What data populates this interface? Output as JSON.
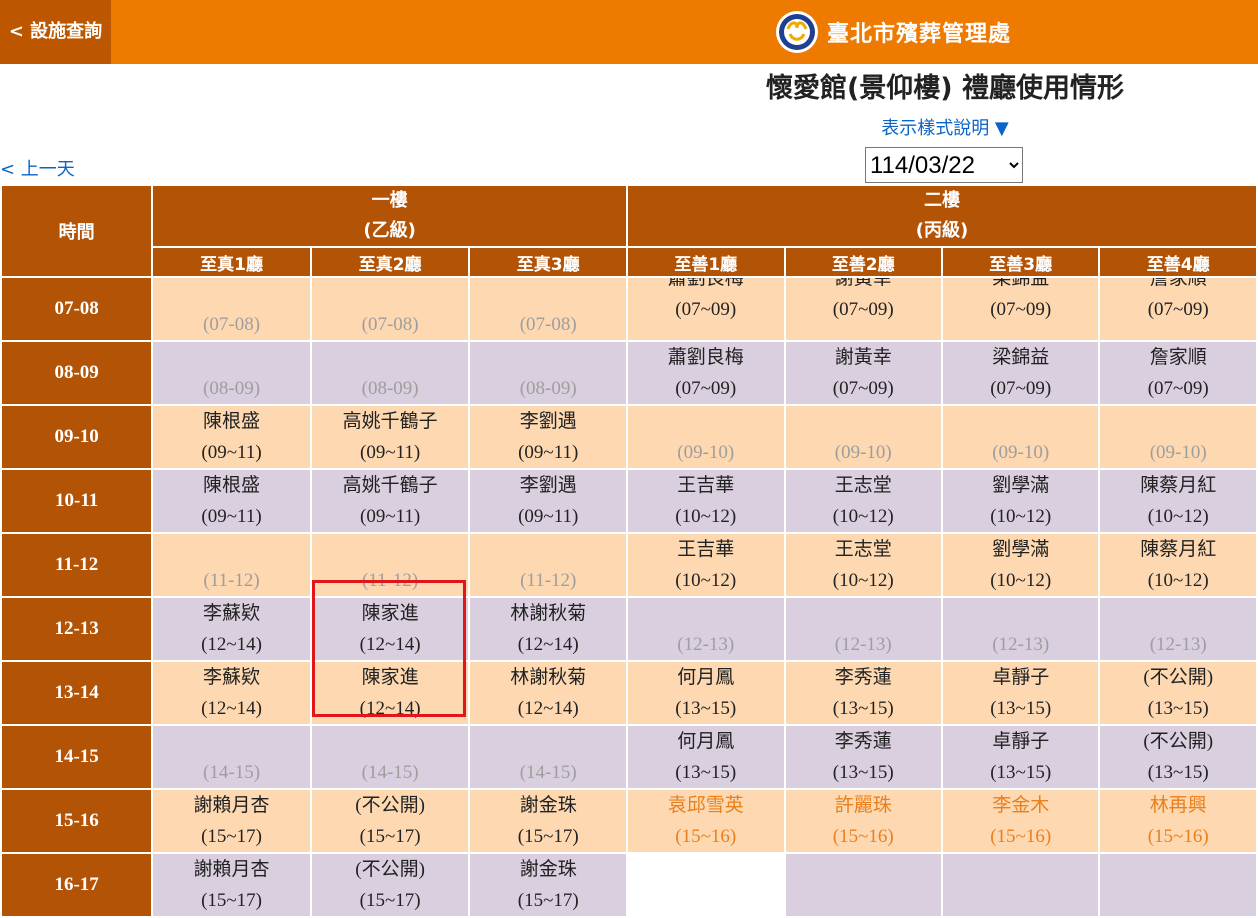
{
  "header": {
    "back_label": "< 設施查詢",
    "brand_name": "臺北市殯葬管理處",
    "bar_color": "#ee7b00",
    "back_color": "#bc5700",
    "logo_icon": "city-funeral-logo-icon"
  },
  "title": "懷愛館(景仰樓) 禮廳使用情形",
  "legend_link": "表示樣式說明 ▼",
  "prev_day": "< 上一天",
  "date_select": {
    "value": "114/03/22",
    "options": [
      "114/03/22"
    ]
  },
  "table": {
    "time_header": "時間",
    "floors": [
      {
        "name": "一樓",
        "grade": "(乙級)"
      },
      {
        "name": "二樓",
        "grade": "(丙級)"
      }
    ],
    "halls": [
      "至真1廳",
      "至真2廳",
      "至真3廳",
      "至善1廳",
      "至善2廳",
      "至善3廳",
      "至善4廳"
    ],
    "rows": [
      {
        "time": "07-08",
        "cells": [
          {
            "name": "",
            "time": "(07-08)",
            "bg": "peach",
            "empty": true
          },
          {
            "name": "",
            "time": "(07-08)",
            "bg": "peach",
            "empty": true
          },
          {
            "name": "",
            "time": "(07-08)",
            "bg": "peach",
            "empty": true
          },
          {
            "name": "蕭劉良梅",
            "time": "(07~09)",
            "bg": "peach",
            "clip": true
          },
          {
            "name": "謝黃幸",
            "time": "(07~09)",
            "bg": "peach",
            "clip": true
          },
          {
            "name": "梁錦益",
            "time": "(07~09)",
            "bg": "peach",
            "clip": true
          },
          {
            "name": "詹家順",
            "time": "(07~09)",
            "bg": "peach",
            "clip": true
          }
        ]
      },
      {
        "time": "08-09",
        "cells": [
          {
            "name": "",
            "time": "(08-09)",
            "bg": "lav",
            "empty": true
          },
          {
            "name": "",
            "time": "(08-09)",
            "bg": "lav",
            "empty": true
          },
          {
            "name": "",
            "time": "(08-09)",
            "bg": "lav",
            "empty": true
          },
          {
            "name": "蕭劉良梅",
            "time": "(07~09)",
            "bg": "lav"
          },
          {
            "name": "謝黃幸",
            "time": "(07~09)",
            "bg": "lav"
          },
          {
            "name": "梁錦益",
            "time": "(07~09)",
            "bg": "lav"
          },
          {
            "name": "詹家順",
            "time": "(07~09)",
            "bg": "lav"
          }
        ]
      },
      {
        "time": "09-10",
        "cells": [
          {
            "name": "陳根盛",
            "time": "(09~11)",
            "bg": "peach"
          },
          {
            "name": "高姚千鶴子",
            "time": "(09~11)",
            "bg": "peach"
          },
          {
            "name": "李劉遇",
            "time": "(09~11)",
            "bg": "peach"
          },
          {
            "name": "",
            "time": "(09-10)",
            "bg": "peach",
            "empty": true
          },
          {
            "name": "",
            "time": "(09-10)",
            "bg": "peach",
            "empty": true
          },
          {
            "name": "",
            "time": "(09-10)",
            "bg": "peach",
            "empty": true
          },
          {
            "name": "",
            "time": "(09-10)",
            "bg": "peach",
            "empty": true
          }
        ]
      },
      {
        "time": "10-11",
        "cells": [
          {
            "name": "陳根盛",
            "time": "(09~11)",
            "bg": "lav"
          },
          {
            "name": "高姚千鶴子",
            "time": "(09~11)",
            "bg": "lav"
          },
          {
            "name": "李劉遇",
            "time": "(09~11)",
            "bg": "lav"
          },
          {
            "name": "王吉華",
            "time": "(10~12)",
            "bg": "lav"
          },
          {
            "name": "王志堂",
            "time": "(10~12)",
            "bg": "lav"
          },
          {
            "name": "劉學滿",
            "time": "(10~12)",
            "bg": "lav"
          },
          {
            "name": "陳蔡月紅",
            "time": "(10~12)",
            "bg": "lav"
          }
        ]
      },
      {
        "time": "11-12",
        "cells": [
          {
            "name": "",
            "time": "(11-12)",
            "bg": "peach",
            "empty": true
          },
          {
            "name": "",
            "time": "(11-12)",
            "bg": "peach",
            "empty": true
          },
          {
            "name": "",
            "time": "(11-12)",
            "bg": "peach",
            "empty": true
          },
          {
            "name": "王吉華",
            "time": "(10~12)",
            "bg": "peach"
          },
          {
            "name": "王志堂",
            "time": "(10~12)",
            "bg": "peach"
          },
          {
            "name": "劉學滿",
            "time": "(10~12)",
            "bg": "peach"
          },
          {
            "name": "陳蔡月紅",
            "time": "(10~12)",
            "bg": "peach"
          }
        ]
      },
      {
        "time": "12-13",
        "cells": [
          {
            "name": "李蘇欵",
            "time": "(12~14)",
            "bg": "lav"
          },
          {
            "name": "陳家進",
            "time": "(12~14)",
            "bg": "lav"
          },
          {
            "name": "林謝秋菊",
            "time": "(12~14)",
            "bg": "lav"
          },
          {
            "name": "",
            "time": "(12-13)",
            "bg": "lav",
            "empty": true
          },
          {
            "name": "",
            "time": "(12-13)",
            "bg": "lav",
            "empty": true
          },
          {
            "name": "",
            "time": "(12-13)",
            "bg": "lav",
            "empty": true
          },
          {
            "name": "",
            "time": "(12-13)",
            "bg": "lav",
            "empty": true
          }
        ]
      },
      {
        "time": "13-14",
        "cells": [
          {
            "name": "李蘇欵",
            "time": "(12~14)",
            "bg": "peach"
          },
          {
            "name": "陳家進",
            "time": "(12~14)",
            "bg": "peach"
          },
          {
            "name": "林謝秋菊",
            "time": "(12~14)",
            "bg": "peach"
          },
          {
            "name": "何月鳳",
            "time": "(13~15)",
            "bg": "peach"
          },
          {
            "name": "李秀蓮",
            "time": "(13~15)",
            "bg": "peach"
          },
          {
            "name": "卓靜子",
            "time": "(13~15)",
            "bg": "peach"
          },
          {
            "name": "(不公開)",
            "time": "(13~15)",
            "bg": "peach"
          }
        ]
      },
      {
        "time": "14-15",
        "cells": [
          {
            "name": "",
            "time": "(14-15)",
            "bg": "lav",
            "empty": true
          },
          {
            "name": "",
            "time": "(14-15)",
            "bg": "lav",
            "empty": true
          },
          {
            "name": "",
            "time": "(14-15)",
            "bg": "lav",
            "empty": true
          },
          {
            "name": "何月鳳",
            "time": "(13~15)",
            "bg": "lav"
          },
          {
            "name": "李秀蓮",
            "time": "(13~15)",
            "bg": "lav"
          },
          {
            "name": "卓靜子",
            "time": "(13~15)",
            "bg": "lav"
          },
          {
            "name": "(不公開)",
            "time": "(13~15)",
            "bg": "lav"
          }
        ]
      },
      {
        "time": "15-16",
        "cells": [
          {
            "name": "謝賴月杏",
            "time": "(15~17)",
            "bg": "peach"
          },
          {
            "name": "(不公開)",
            "time": "(15~17)",
            "bg": "peach"
          },
          {
            "name": "謝金珠",
            "time": "(15~17)",
            "bg": "peach"
          },
          {
            "name": "袁邱雪英",
            "time": "(15~16)",
            "bg": "peach",
            "orange": true
          },
          {
            "name": "許麗珠",
            "time": "(15~16)",
            "bg": "peach",
            "orange": true
          },
          {
            "name": "李金木",
            "time": "(15~16)",
            "bg": "peach",
            "orange": true
          },
          {
            "name": "林再興",
            "time": "(15~16)",
            "bg": "peach",
            "orange": true
          }
        ]
      },
      {
        "time": "16-17",
        "cells": [
          {
            "name": "謝賴月杏",
            "time": "(15~17)",
            "bg": "lav"
          },
          {
            "name": "(不公開)",
            "time": "(15~17)",
            "bg": "lav"
          },
          {
            "name": "謝金珠",
            "time": "(15~17)",
            "bg": "lav"
          },
          {
            "name": "",
            "time": "",
            "bg": "white",
            "empty": true
          },
          {
            "name": "",
            "time": "",
            "bg": "lav",
            "empty": true
          },
          {
            "name": "",
            "time": "",
            "bg": "lav",
            "empty": true
          },
          {
            "name": "",
            "time": "",
            "bg": "lav",
            "empty": true
          }
        ]
      }
    ]
  },
  "colors": {
    "header_bg": "#b35306",
    "peach": "#fdd8b0",
    "lavender": "#dacfdf",
    "empty_text": "#9e9e9e",
    "highlight": "#e0161b",
    "link": "#0a63c8"
  }
}
